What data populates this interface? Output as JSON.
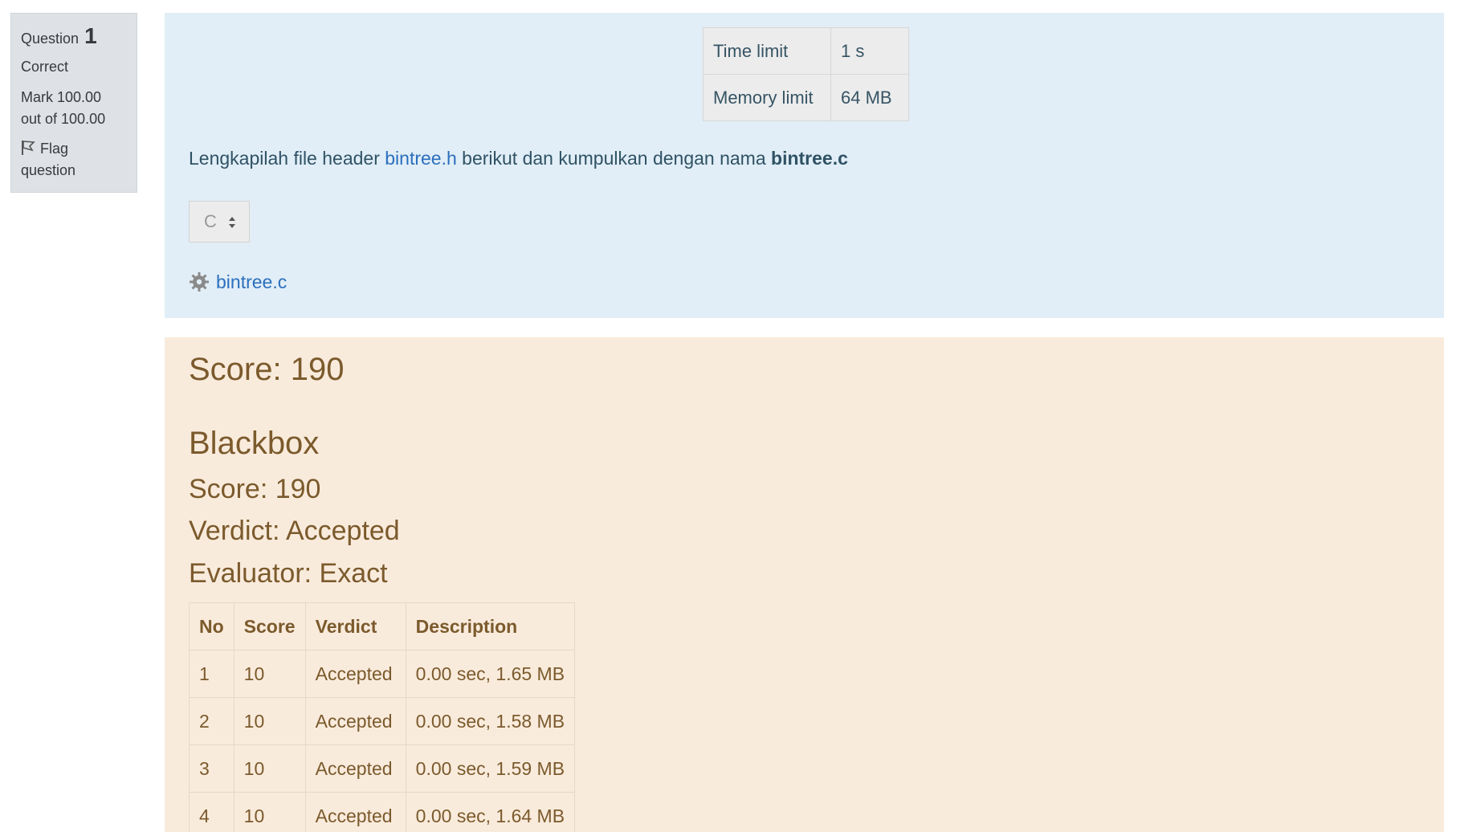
{
  "question_info": {
    "question_label": "Question",
    "question_number": "1",
    "state": "Correct",
    "mark_line1": "Mark 100.00",
    "mark_line2": "out of 100.00",
    "flag_line1": "Flag",
    "flag_line2": "question",
    "flag_icon": "flag-icon"
  },
  "limits": [
    {
      "label": "Time limit",
      "value": "1 s"
    },
    {
      "label": "Memory limit",
      "value": "64 MB"
    }
  ],
  "question_text": {
    "before_link": "Lengkapilah file header ",
    "link": "bintree.h",
    "middle": " berikut dan kumpulkan dengan nama ",
    "filename_bold": "bintree.c"
  },
  "language_select": {
    "selected": "C",
    "icon": "sort-arrows-icon"
  },
  "attachment": {
    "icon": "gear-icon",
    "filename": "bintree.c"
  },
  "feedback": {
    "score": "Score: 190",
    "section_title": "Blackbox",
    "section_score": "Score: 190",
    "verdict": "Verdict: Accepted",
    "evaluator": "Evaluator: Exact",
    "table": {
      "headers": [
        "No",
        "Score",
        "Verdict",
        "Description"
      ],
      "rows": [
        [
          "1",
          "10",
          "Accepted",
          "0.00 sec, 1.65 MB"
        ],
        [
          "2",
          "10",
          "Accepted",
          "0.00 sec, 1.58 MB"
        ],
        [
          "3",
          "10",
          "Accepted",
          "0.00 sec, 1.59 MB"
        ],
        [
          "4",
          "10",
          "Accepted",
          "0.00 sec, 1.64 MB"
        ]
      ]
    }
  },
  "colors": {
    "info_bg": "#dee2e6",
    "formulation_bg": "#e1eef7",
    "feedback_bg": "#f9ebdc",
    "link": "#2b6fbd",
    "feedback_text": "#7b5a2c"
  }
}
